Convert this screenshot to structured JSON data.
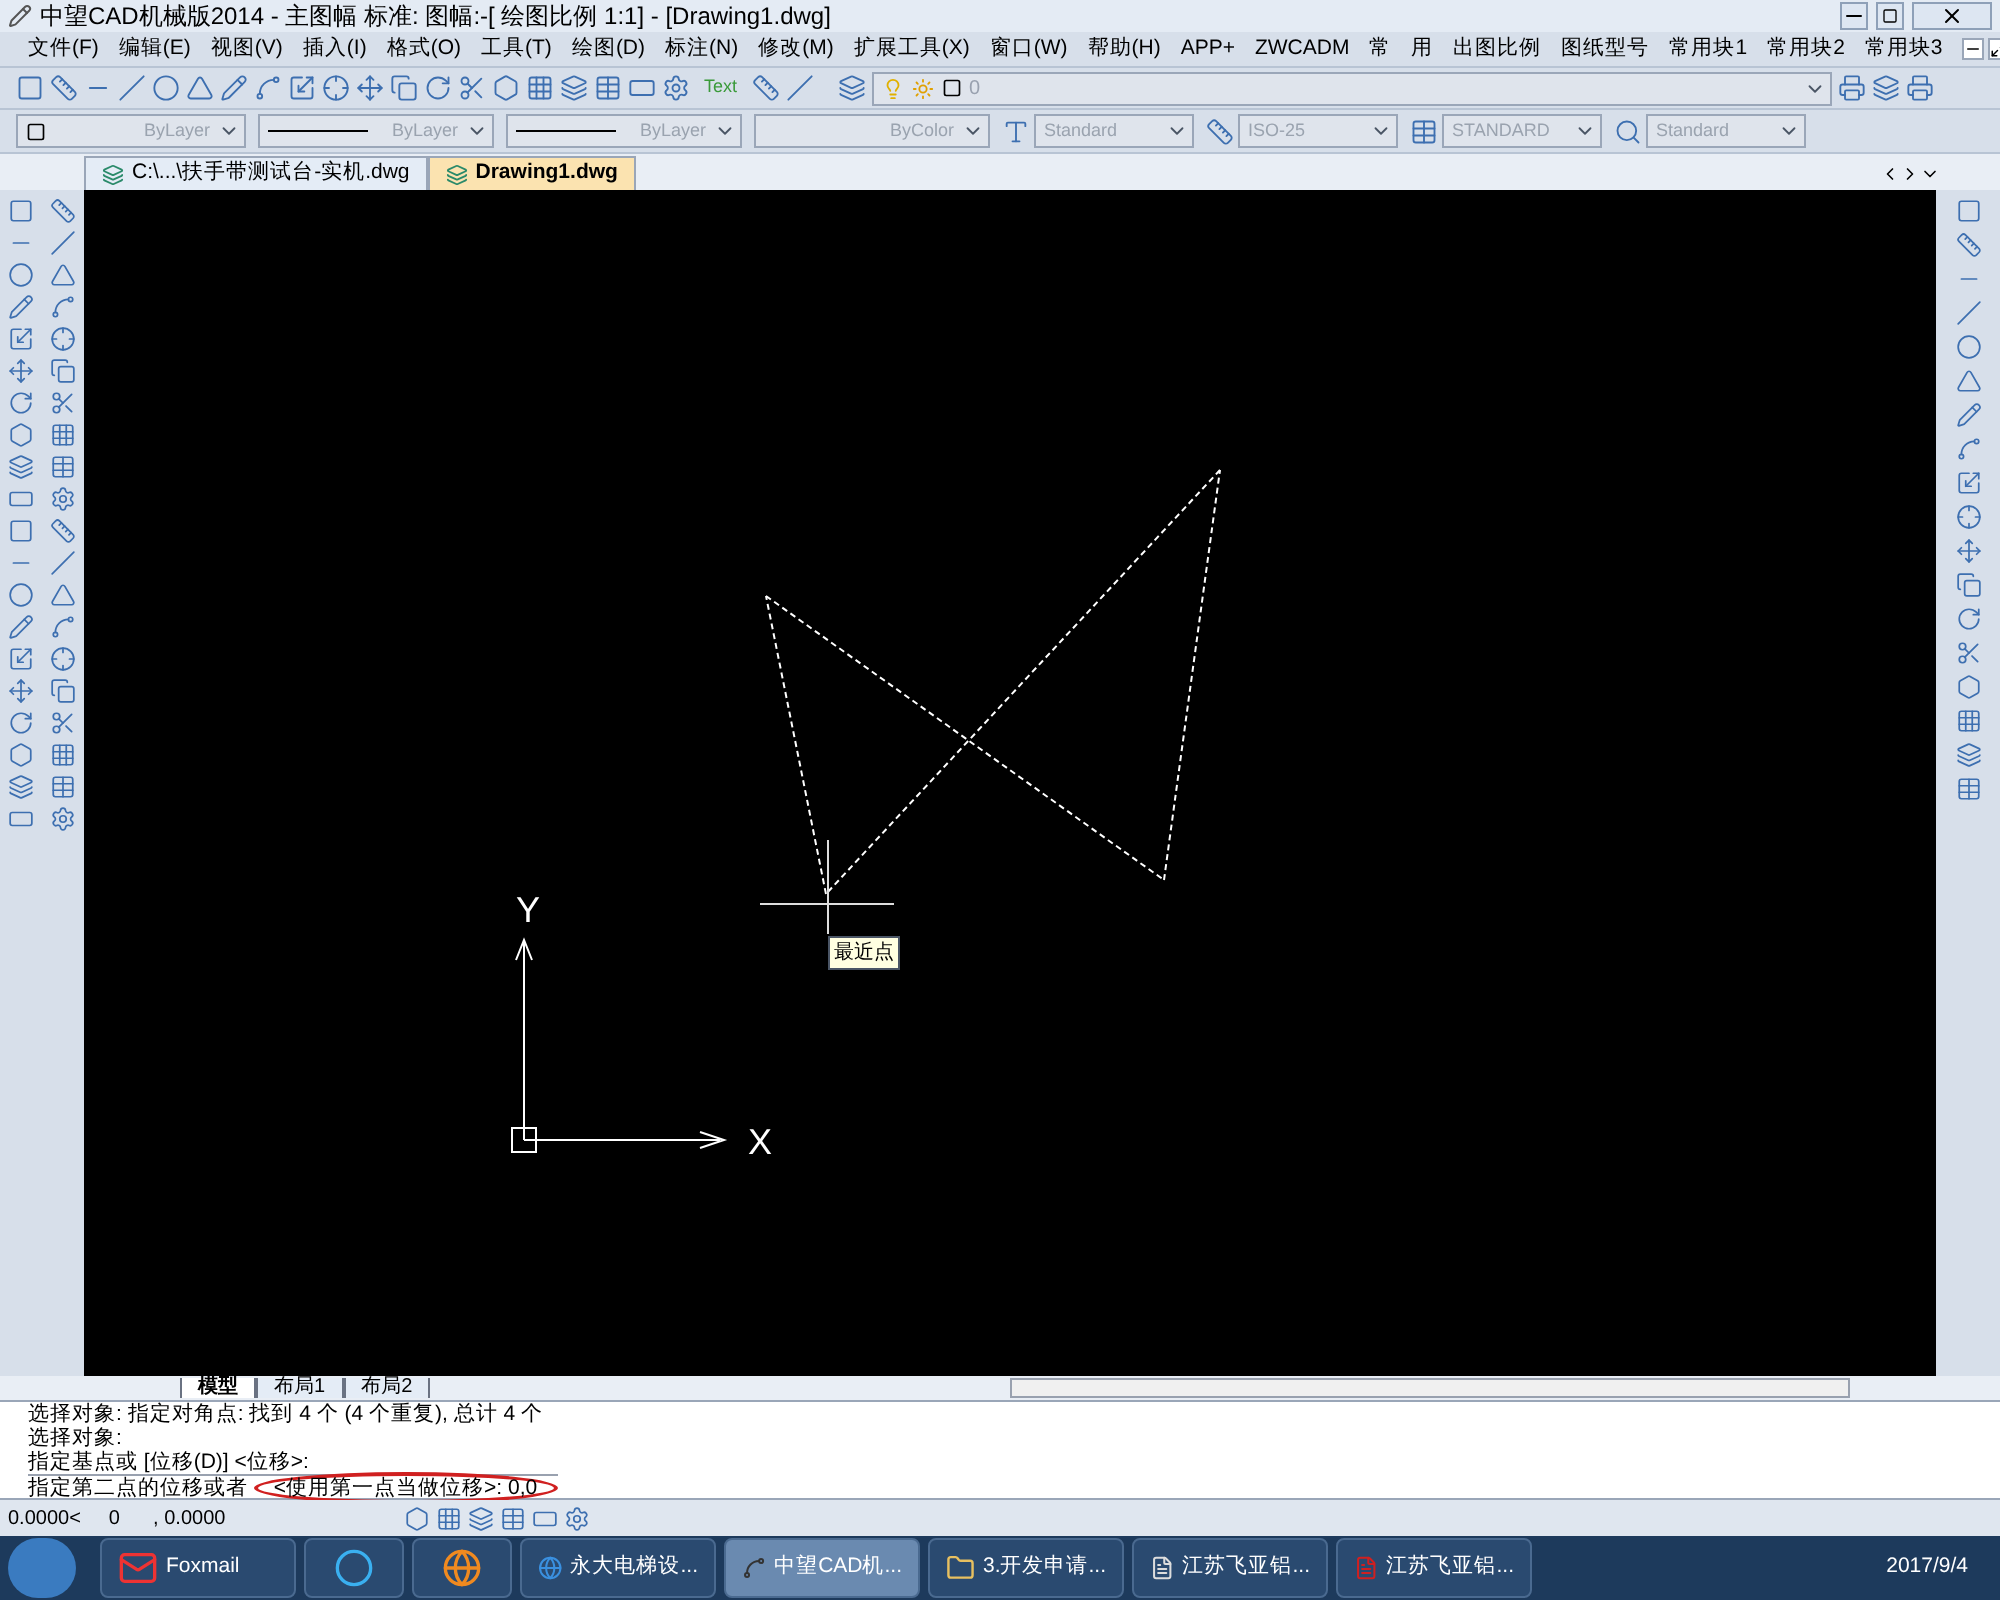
{
  "window": {
    "title": "中望CAD机械版2014 - 主图幅  标准: 图幅:-[ 绘图比例 1:1] - [Drawing1.dwg]"
  },
  "menu": [
    "文件(F)",
    "编辑(E)",
    "视图(V)",
    "插入(I)",
    "格式(O)",
    "工具(T)",
    "绘图(D)",
    "标注(N)",
    "修改(M)",
    "扩展工具(X)",
    "窗口(W)",
    "帮助(H)",
    "APP+",
    "ZWCADM",
    "常",
    "用",
    "出图比例",
    "图纸型号",
    "常用块1",
    "常用块2",
    "常用块3"
  ],
  "toolbar": {
    "text_tool": "Text",
    "layer_value": "0"
  },
  "properties": [
    {
      "value": "ByLayer",
      "kind": "color"
    },
    {
      "value": "ByLayer",
      "kind": "linetype"
    },
    {
      "value": "ByLayer",
      "kind": "linetype"
    },
    {
      "value": "ByColor",
      "kind": "plain"
    }
  ],
  "styles": [
    {
      "value": "Standard"
    },
    {
      "value": "ISO-25"
    },
    {
      "value": "STANDARD"
    },
    {
      "value": "Standard"
    }
  ],
  "doc_tabs": [
    {
      "label": "C:\\...\\扶手带测试台-实机.dwg",
      "selected": false
    },
    {
      "label": "Drawing1.dwg",
      "selected": true
    }
  ],
  "canvas": {
    "snap_tooltip": "最近点",
    "axis_x": "X",
    "axis_y": "Y"
  },
  "layout_tabs": [
    {
      "label": "模型",
      "selected": true
    },
    {
      "label": "布局1",
      "selected": false
    },
    {
      "label": "布局2",
      "selected": false
    }
  ],
  "command_lines": [
    "选择对象: 指定对角点: 找到 4 个 (4 个重复), 总计 4 个",
    "选择对象:",
    "指定基点或 [位移(D)] <位移>:"
  ],
  "prompt": {
    "text": "指定第二点的位移或者",
    "circled_text": "<使用第一点当做位移>: 0,0"
  },
  "status": {
    "coordinates": "0.0000<     0      , 0.0000"
  },
  "taskbar": [
    {
      "label": "Foxmail",
      "kind": "mail",
      "selected": false
    },
    {
      "kind": "s-app",
      "selected": false
    },
    {
      "kind": "browser",
      "selected": false
    },
    {
      "label": "永大电梯设...",
      "kind": "ie",
      "selected": false
    },
    {
      "label": "中望CAD机...",
      "kind": "cad",
      "selected": true
    },
    {
      "label": "3.开发申请...",
      "kind": "folder",
      "selected": false
    },
    {
      "label": "江苏飞亚铝...",
      "kind": "doc",
      "selected": false
    },
    {
      "label": "江苏飞亚铝...",
      "kind": "pdf",
      "selected": false
    }
  ],
  "clock": {
    "date": "2017/9/4"
  }
}
